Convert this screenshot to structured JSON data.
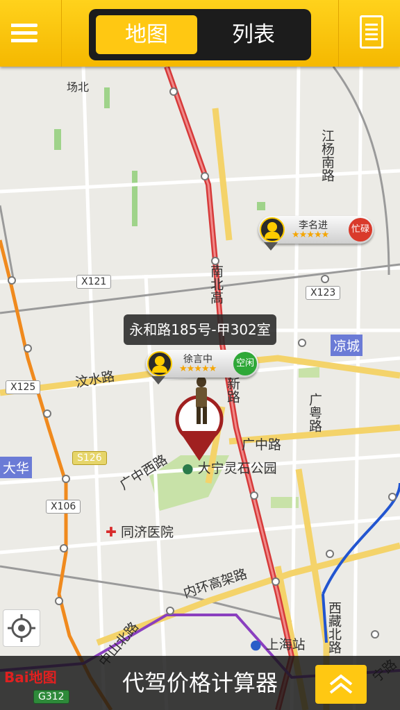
{
  "header": {
    "tab_map": "地图",
    "tab_list": "列表",
    "menu_icon": "menu-icon",
    "doc_icon": "document-icon"
  },
  "map": {
    "place_labels": {
      "changbei": "场北",
      "jiangyang": "江杨南路",
      "liangcheng": "凉城",
      "nanbei": "南北高",
      "gonghe": "和新路",
      "wenshui": "汶水路",
      "guangyue": "广粤路",
      "guangzhong": "广中路",
      "guangzhongxi": "广中西路",
      "park": "大宁灵石公园",
      "hospital": "同济医院",
      "neihuan": "内环高架路",
      "zhongshan": "中山北路",
      "shanghai_station": "上海站",
      "xizang": "西藏北路",
      "dahua": "大华",
      "ning": "宁路"
    },
    "highway_tags": [
      "X121",
      "X123",
      "X125",
      "S126",
      "X106",
      "G312"
    ],
    "address_callout": "永和路185号-甲302室",
    "drivers": [
      {
        "name": "李名进",
        "stars": "★★★★★",
        "status": "忙碌",
        "status_color": "#d93a2b"
      },
      {
        "name": "徐言中",
        "stars": "★★★★★",
        "status": "空闲",
        "status_color": "#2fa838"
      }
    ],
    "baidu_logo": "Bai地图"
  },
  "footer": {
    "title": "代驾价格计算器",
    "expand_icon": "double-chevron-up-icon"
  },
  "colors": {
    "accent": "#ffc812",
    "topbar": "#f5b800"
  }
}
